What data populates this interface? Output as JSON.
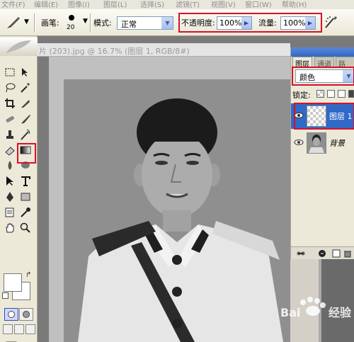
{
  "menu": [
    "文件(F)",
    "编辑(E)",
    "图像(I)",
    "图层(L)",
    "选择(S)",
    "滤镜(T)",
    "视图(V)",
    "窗口(W)",
    "帮助(H)"
  ],
  "options": {
    "brush_label": "画笔:",
    "brush_size": "20",
    "mode_label": "模式:",
    "mode_value": "正常",
    "opacity_label": "不透明度:",
    "opacity_value": "100%",
    "flow_label": "流量:",
    "flow_value": "100%"
  },
  "document": {
    "title": "片 (203).jpg @ 16.7% (图层 1, RGB/8#)"
  },
  "layers_panel": {
    "tabs": [
      "图层",
      "通道",
      "路径"
    ],
    "blend_mode": "颜色",
    "lock_label": "锁定:",
    "layers": [
      {
        "name": "图层 1",
        "selected": true
      },
      {
        "name": "背景",
        "selected": false
      }
    ]
  },
  "icons": [
    "brush-icon",
    "marquee-icon",
    "move-icon",
    "lasso-icon",
    "magic-wand-icon",
    "crop-icon",
    "slice-icon",
    "healing-icon",
    "stamp-icon",
    "history-brush-icon",
    "eraser-icon",
    "gradient-icon",
    "blur-icon",
    "dodge-icon",
    "path-select-icon",
    "type-icon",
    "pen-icon",
    "shape-icon",
    "notes-icon",
    "eyedropper-icon",
    "hand-icon",
    "zoom-icon",
    "eye-icon",
    "airbrush-icon",
    "link-icon",
    "fx-icon"
  ],
  "colors": {
    "highlight": "#d8102a",
    "selection": "#3169c6",
    "panel": "#ece9d8"
  }
}
